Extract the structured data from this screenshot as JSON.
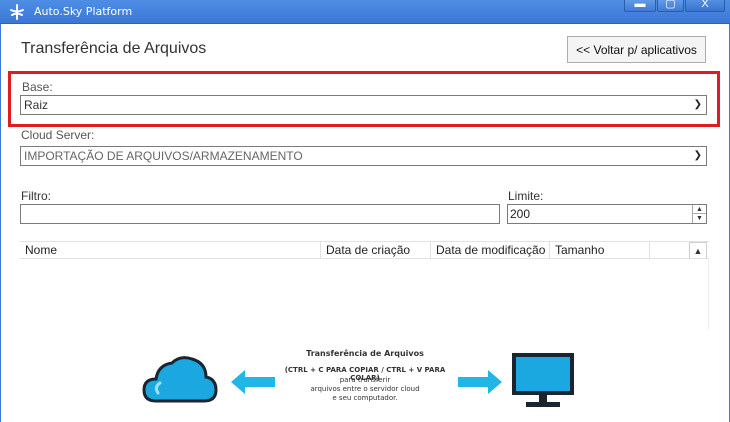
{
  "window": {
    "title": "Auto.Sky Platform",
    "controls": {
      "minimize": "▬",
      "maximize": "▢",
      "close": "X"
    }
  },
  "header": {
    "title": "Transferência de Arquivos",
    "back_button": "<< Voltar p/ aplicativos"
  },
  "base": {
    "label": "Base:",
    "value": "Raiz"
  },
  "cloud_server": {
    "label": "Cloud Server:",
    "value": "IMPORTAÇÃO DE ARQUIVOS/ARMAZENAMENTO"
  },
  "filtro": {
    "label": "Filtro:",
    "value": ""
  },
  "limite": {
    "label": "Limite:",
    "value": "200"
  },
  "table": {
    "columns": [
      "Nome",
      "Data de criação",
      "Data de modificação",
      "Tamanho"
    ],
    "rows": []
  },
  "info": {
    "title": "Transferência de Arquivos",
    "shortcut": "(CTRL + C PARA COPIAR / CTRL + V PARA COLAR)",
    "desc_line1": "para transferir",
    "desc_line2": "arquivos entre o servidor cloud",
    "desc_line3": "e seu computador."
  },
  "colors": {
    "titlebar": "#3b78d6",
    "highlight": "#e11b22",
    "cloud": "#1ba8e0",
    "arrow": "#22b5e8"
  },
  "icons": [
    "app-logo-icon",
    "chevron-down-icon",
    "spin-up-icon",
    "spin-down-icon",
    "cloud-icon",
    "computer-icon",
    "arrow-left-icon",
    "arrow-right-icon"
  ]
}
